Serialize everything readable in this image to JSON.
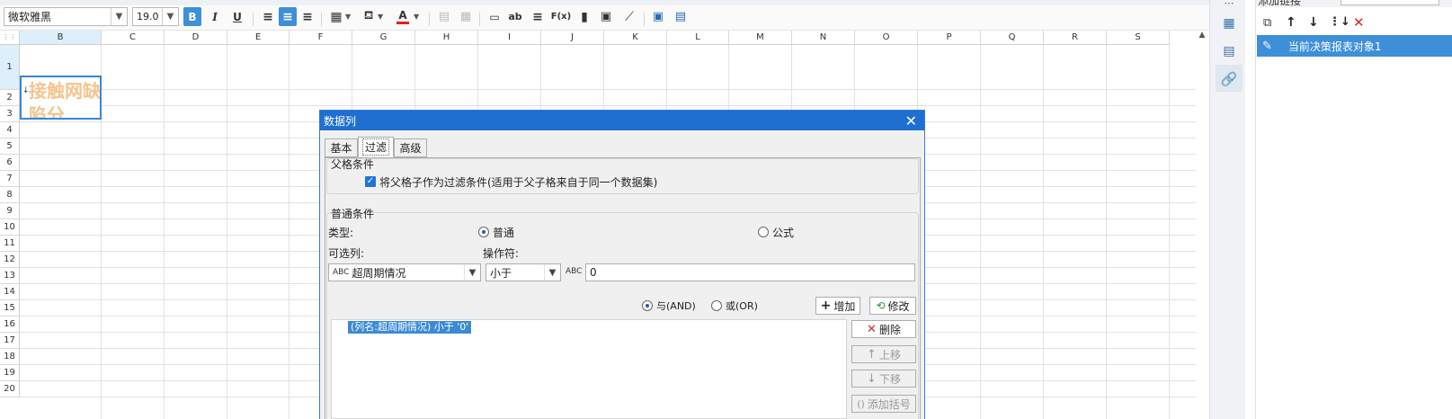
{
  "toolbar": {
    "font_name": "微软雅黑",
    "font_size": "19.0",
    "bold": "B",
    "italic": "I",
    "underline": "U",
    "font_color_letter": "A",
    "text_label": "ab",
    "formula_label": "F(x)"
  },
  "sheet": {
    "columns": [
      "B",
      "C",
      "D",
      "E",
      "F",
      "G",
      "H",
      "I",
      "J",
      "K",
      "L",
      "M",
      "N",
      "O",
      "P",
      "Q",
      "R",
      "S"
    ],
    "rows": [
      "1",
      "2",
      "3",
      "4",
      "5",
      "6",
      "7",
      "8",
      "9",
      "10",
      "11",
      "12",
      "13",
      "14",
      "15",
      "16",
      "17",
      "18",
      "19",
      "20"
    ],
    "cell_b1_text": "接触网缺陷分"
  },
  "right_panel": {
    "title_partial": "添加链接",
    "item_label": "当前决策报表对象1"
  },
  "dialog": {
    "title": "数据列",
    "tabs": [
      "基本",
      "过滤",
      "高级"
    ],
    "parent_section_title": "父格条件",
    "parent_checkbox_label": "将父格子作为过滤条件(适用于父子格来自于同一个数据集)",
    "normal_section_title": "普通条件",
    "type_label": "类型:",
    "type_normal": "普通",
    "type_formula": "公式",
    "column_label": "可选列:",
    "operator_label": "操作符:",
    "column_value": "超周期情况",
    "operator_value": "小于",
    "value_input": "0",
    "and_label": "与(AND)",
    "or_label": "或(OR)",
    "add_label": "增加",
    "modify_label": "修改",
    "condition_item": "(列名:超周期情况) 小于 '0'",
    "delete_label": "删除",
    "up_label": "上移",
    "down_label": "下移",
    "add_bracket_label": "添加括号"
  }
}
